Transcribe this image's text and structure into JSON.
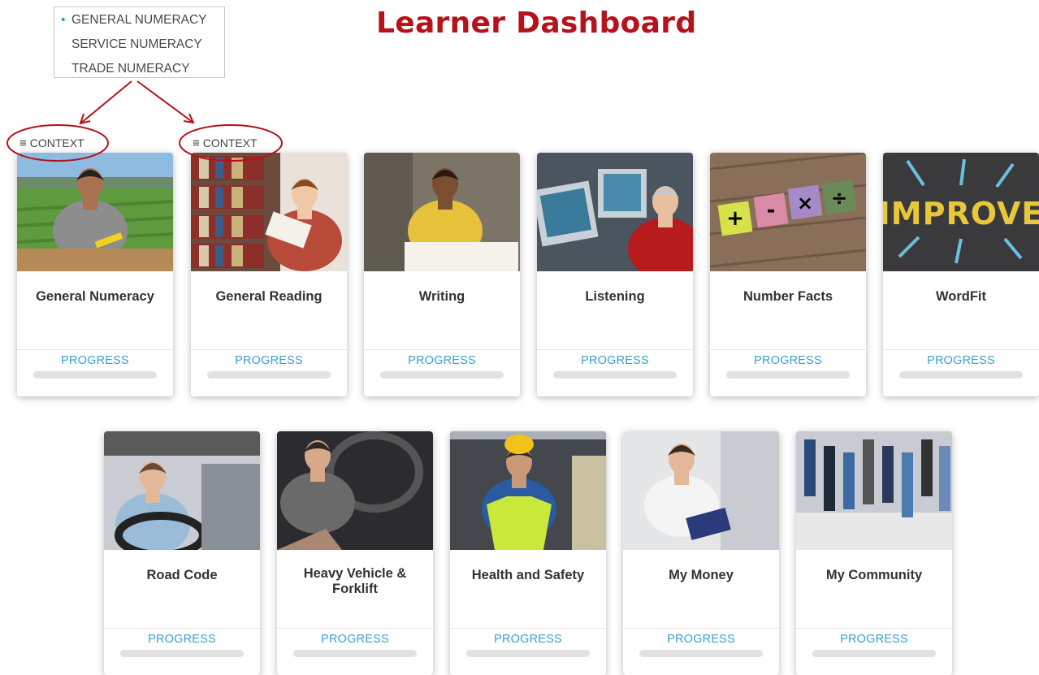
{
  "page_title": "Learner Dashboard",
  "context_menu": {
    "items": [
      {
        "label": "GENERAL NUMERACY",
        "active": true
      },
      {
        "label": "SERVICE NUMERACY",
        "active": false
      },
      {
        "label": "TRADE NUMERACY",
        "active": false
      }
    ]
  },
  "context_buttons": [
    {
      "label": "CONTEXT"
    },
    {
      "label": "CONTEXT"
    }
  ],
  "colors": {
    "title": "#b5121b",
    "accent": "#3a9fd2",
    "annotation": "#b5121b"
  },
  "progress_label": "PROGRESS",
  "cards": [
    {
      "title": "General Numeracy",
      "progress": 0
    },
    {
      "title": "General Reading",
      "progress": 0
    },
    {
      "title": "Writing",
      "progress": 0
    },
    {
      "title": "Listening",
      "progress": 0
    },
    {
      "title": "Number Facts",
      "progress": 0
    },
    {
      "title": "WordFit",
      "progress": 0
    },
    {
      "title": "Road Code",
      "progress": 0
    },
    {
      "title": "Heavy Vehicle & Forklift",
      "progress": 0
    },
    {
      "title": "Health and Safety",
      "progress": 0
    },
    {
      "title": "My Money",
      "progress": 0
    },
    {
      "title": "My Community",
      "progress": 0
    }
  ],
  "images": {
    "wordfit_word": "IMPROVE",
    "number_facts_symbols": [
      "+",
      "-",
      "×",
      "÷"
    ]
  }
}
